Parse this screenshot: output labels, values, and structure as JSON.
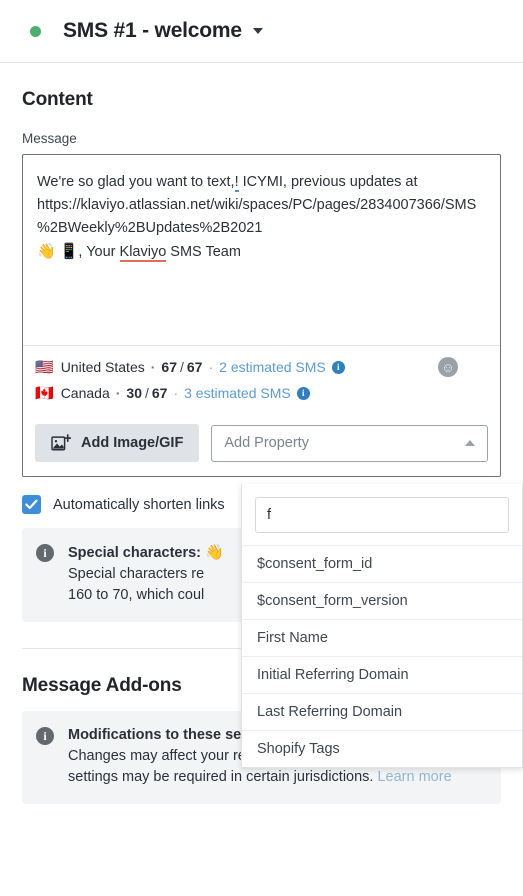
{
  "header": {
    "status": "active",
    "status_color": "#4caf72",
    "title": "SMS #1 - welcome",
    "caret_icon": "chevron-down-icon"
  },
  "content": {
    "section_title": "Content",
    "message_label": "Message",
    "message_lines": {
      "l1_a": "We're so glad you want to text,",
      "l1_b": "!",
      "l1_c": " ICYMI, previous updates at",
      "l2": "https://klaviyo.atlassian.net/wiki/spaces/PC/pages/2834007366/SMS%2BWeekly%2BUpdates%2B2021",
      "l3_emoji1": "👋",
      "l3_emoji2": "📱",
      "l3_a": ", Your ",
      "l3_b": "Klaviyo",
      "l3_c": " SMS Team"
    },
    "counters": [
      {
        "flag": "🇺🇸",
        "country": "United States",
        "used": "67",
        "limit": "67",
        "estimate": "2 estimated SMS",
        "info_icon": "info-icon"
      },
      {
        "flag": "🇨🇦",
        "country": "Canada",
        "used": "30",
        "limit": "67",
        "estimate": "3 estimated SMS",
        "info_icon": "info-icon"
      }
    ],
    "emoji_picker_icon": "emoji-smiley-icon",
    "add_image_button": "Add Image/GIF",
    "add_image_icon": "image-plus-icon",
    "add_property_select": "Add Property",
    "add_property_caret_icon": "chevron-up-icon",
    "shorten_links_label": "Automatically shorten links",
    "shorten_links_checked": true,
    "special_chars_callout": {
      "icon": "info-icon",
      "title_prefix": "Special characters: ",
      "title_emoji": "👋",
      "line2": "Special characters re",
      "line3": "160 to 70, which coul"
    }
  },
  "dropdown": {
    "search_value": "f",
    "search_placeholder": "",
    "items": [
      "$consent_form_id",
      "$consent_form_version",
      "First Name",
      "Initial Referring Domain",
      "Last Referring Domain",
      "Shopify Tags"
    ]
  },
  "addons": {
    "section_title": "Message Add-ons",
    "callout": {
      "icon": "info-icon",
      "title": "Modifications to these settings are not recommended",
      "body": "Changes may affect your reputation and deliverability and these settings may be required in certain jurisdictions. ",
      "link": "Learn more",
      "collapse_icon": "chevron-up-icon"
    }
  },
  "colors": {
    "accent_blue": "#3d8ed8",
    "status_green": "#4caf72",
    "link_blue": "#5b9bd5",
    "callout_bg": "#f3f4f6"
  }
}
